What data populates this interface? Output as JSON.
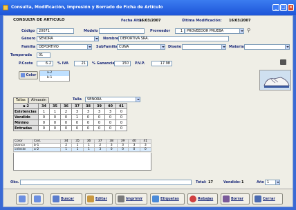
{
  "window": {
    "title": "Consulta, Modificación, Impresión y Borrado de Ficha de Artículo"
  },
  "header": {
    "section": "CONSULTA DE ARTICULO",
    "alta_label": "Fecha Alta:",
    "alta": "16/03/2007",
    "mod_label": "Última Modificación:",
    "mod": "16/03/2007"
  },
  "form": {
    "codigo_label": "Código",
    "codigo": "20071",
    "modelo_label": "Modelo",
    "modelo": "",
    "proveedor_label": "Proveedor",
    "proveedor_num": "1",
    "proveedor": "PROVEEDOR PRUEBA",
    "genero_label": "Género",
    "genero": "SEÑORA",
    "nombre_label": "Nombre",
    "nombre": "DEPORTIVA SRA.",
    "familia_label": "Familia",
    "familia": "DEPORTIVO",
    "subfamilia_label": "SubFamilia",
    "subfamilia": "CUÑA",
    "diseno_label": "Diseño",
    "diseno": "",
    "material_label": "Material",
    "material": "",
    "temporada_label": "Temporada",
    "temporada": "01",
    "pcoste_label": "P.Coste",
    "pcoste": "6.2",
    "iva_label": "% IVA",
    "iva": "21",
    "ganancia_label": "% Ganancia",
    "ganancia": "150",
    "pvp_label": "P.V.P.",
    "pvp": "17.98",
    "color_label": "Color",
    "color_options": [
      "a-2",
      "b-1"
    ]
  },
  "tabs": [
    "Tallas",
    "Almacén"
  ],
  "talla": {
    "label": "Talla",
    "value": "SEÑORA"
  },
  "sizes": {
    "headers": [
      "a-2",
      "34",
      "35",
      "36",
      "37",
      "38",
      "39",
      "40",
      "41"
    ],
    "rows": [
      {
        "name": "Existencias",
        "vals": [
          "1",
          "1",
          "2",
          "3",
          "3",
          "3",
          "3"
        ]
      },
      {
        "name": "Vendido",
        "vals": [
          "0",
          "0",
          "0",
          "1",
          "0",
          "0",
          "0"
        ]
      },
      {
        "name": "Mínimo",
        "vals": [
          "0",
          "0",
          "0",
          "0",
          "0",
          "0",
          "0"
        ]
      },
      {
        "name": "Entradas",
        "vals": [
          "0",
          "0",
          "0",
          "0",
          "0",
          "0",
          "0"
        ]
      }
    ]
  },
  "colors": {
    "headers": [
      "Color",
      "Cód.",
      "34",
      "35",
      "36",
      "37",
      "38",
      "39",
      "40",
      "41"
    ],
    "rows": [
      {
        "c": "blanco",
        "code": "b-1",
        "v": [
          "2",
          "1",
          "1",
          "2",
          "3",
          "3",
          "3",
          "3"
        ]
      },
      {
        "c": "celeste",
        "code": "a-2",
        "v": [
          "1",
          "1",
          "1",
          "3",
          "0",
          "0",
          "0",
          "0"
        ]
      }
    ]
  },
  "footer": {
    "obs_label": "Obs.",
    "total_label": "Total:",
    "total": "17",
    "vendido_label": "Vendido:",
    "vendido": "1",
    "ano_label": "Año",
    "ano": "1"
  },
  "buttons": {
    "buscar": "Buscar",
    "editar": "Editar",
    "imprimir": "Imprimir",
    "etiquetas": "Etiquetas",
    "rebajas": "Rebajas",
    "borrar": "Borrar",
    "cerrar": "Cerrar"
  }
}
